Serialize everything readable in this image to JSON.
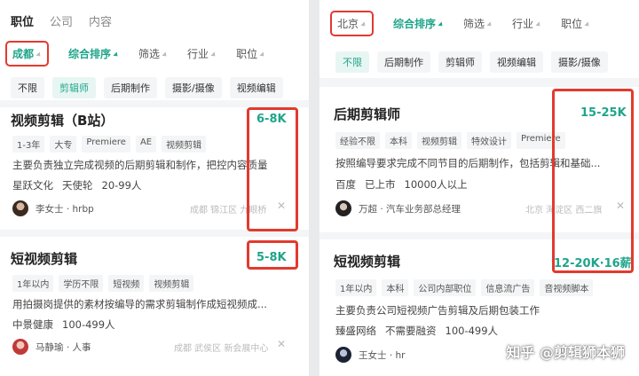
{
  "left": {
    "tabs": [
      "职位",
      "公司",
      "内容"
    ],
    "city": "成都",
    "filters": [
      "综合排序",
      "筛选",
      "行业",
      "职位"
    ],
    "chips": [
      "不限",
      "剪辑师",
      "后期制作",
      "摄影/摄像",
      "视频编辑"
    ],
    "jobs": [
      {
        "title": "视频剪辑（B站）",
        "salary": "6-8K",
        "tags": [
          "1-3年",
          "大专",
          "Premiere",
          "AE",
          "视频剪辑"
        ],
        "desc": "主要负责独立完成视频的后期剪辑和制作，把控内容质量",
        "company": [
          "星跃文化",
          "天使轮",
          "20-99人"
        ],
        "recruiter": "李女士 · hrbp",
        "location": "成都  锦江区  九眼桥"
      },
      {
        "title": "短视频剪辑",
        "salary": "5-8K",
        "tags": [
          "1年以内",
          "学历不限",
          "短视频",
          "视频剪辑"
        ],
        "desc": "用拍摄岗提供的素材按编导的需求剪辑制作成短视频成...",
        "company": [
          "中景健康",
          "100-499人"
        ],
        "recruiter": "马静瑜 · 人事",
        "location": "成都  武侯区  新会展中心"
      }
    ]
  },
  "right": {
    "city": "北京",
    "filters": [
      "综合排序",
      "筛选",
      "行业",
      "职位"
    ],
    "chips": [
      "不限",
      "后期制作",
      "剪辑师",
      "视频编辑",
      "摄影/摄像"
    ],
    "jobs": [
      {
        "title": "后期剪辑师",
        "salary": "15-25K",
        "tags": [
          "经验不限",
          "本科",
          "视频剪辑",
          "特效设计",
          "Premiere"
        ],
        "desc": "按照编导要求完成不同节目的后期制作，包括剪辑和基础...",
        "company": [
          "百度",
          "已上市",
          "10000人以上"
        ],
        "recruiter": "万超 · 汽车业务部总经理",
        "location": "北京  海淀区  西二旗"
      },
      {
        "title": "短视频剪辑",
        "salary": "12-20K·16薪",
        "tags": [
          "1年以内",
          "本科",
          "公司内部职位",
          "信息流广告",
          "音视频脚本"
        ],
        "desc": "主要负责公司短视频广告剪辑及后期包装工作",
        "company": [
          "臻盛网络",
          "不需要融资",
          "100-499人"
        ],
        "recruiter": "王女士 · hr"
      }
    ]
  },
  "watermark": "知乎 @剪辑狮本狮"
}
